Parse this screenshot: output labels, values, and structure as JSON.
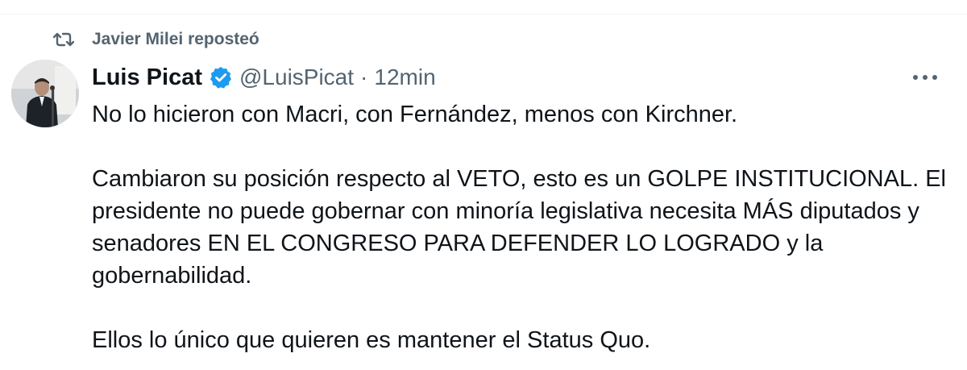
{
  "social_context": {
    "reposted_by": "Javier Milei reposteó"
  },
  "tweet": {
    "display_name": "Luis Picat",
    "handle": "@LuisPicat",
    "separator": "·",
    "time": "12min",
    "paragraphs": [
      "No lo hicieron con Macri, con Fernández, menos con Kirchner.",
      "Cambiaron su posición respecto al VETO, esto es un GOLPE INSTITUCIONAL. El presidente no puede gobernar con minoría legislativa necesita MÁS diputados y senadores EN EL CONGRESO PARA DEFENDER LO LOGRADO y la gobernabilidad.",
      "Ellos lo único que quieren es mantener el Status Quo."
    ]
  },
  "icons": {
    "repost": "repost-icon",
    "verified": "verified-badge-icon",
    "more": "more-options-icon"
  },
  "colors": {
    "text_primary": "#0f1419",
    "text_secondary": "#536471",
    "verified_blue": "#1d9bf0"
  }
}
